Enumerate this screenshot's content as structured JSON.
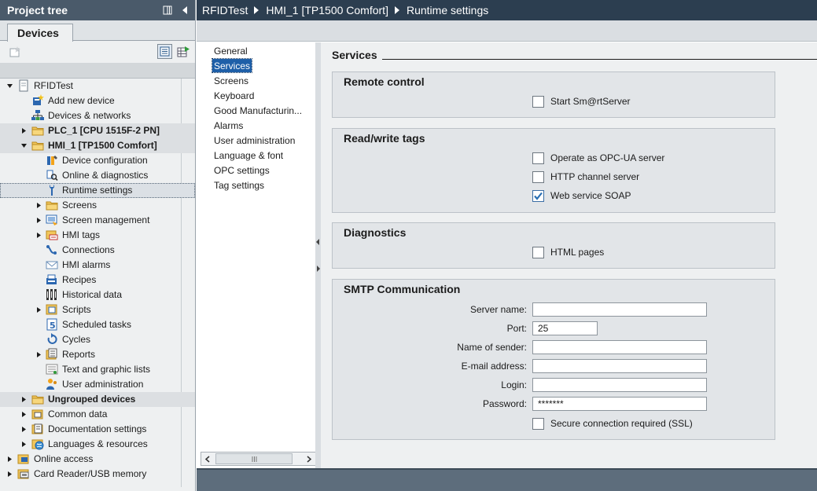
{
  "project_tree": {
    "title": "Project tree",
    "tab_label": "Devices",
    "items": [
      {
        "label": "RFIDTest",
        "level": 0,
        "chevron": "down",
        "icon": "project-icon",
        "bold": false
      },
      {
        "label": "Add new device",
        "level": 1,
        "chevron": "none",
        "icon": "add-device-icon",
        "bold": false
      },
      {
        "label": "Devices & networks",
        "level": 1,
        "chevron": "none",
        "icon": "network-icon",
        "bold": false
      },
      {
        "label": "PLC_1 [CPU 1515F-2 PN]",
        "level": 1,
        "chevron": "right",
        "icon": "folder-icon",
        "bold": true
      },
      {
        "label": "HMI_1 [TP1500 Comfort]",
        "level": 1,
        "chevron": "down",
        "icon": "folder-icon",
        "bold": true
      },
      {
        "label": "Device configuration",
        "level": 2,
        "chevron": "none",
        "icon": "device-config-icon",
        "bold": false
      },
      {
        "label": "Online & diagnostics",
        "level": 2,
        "chevron": "none",
        "icon": "diagnostics-icon",
        "bold": false
      },
      {
        "label": "Runtime settings",
        "level": 2,
        "chevron": "none",
        "icon": "runtime-settings-icon",
        "bold": false,
        "selected": true
      },
      {
        "label": "Screens",
        "level": 2,
        "chevron": "right",
        "icon": "folder-icon",
        "bold": false
      },
      {
        "label": "Screen management",
        "level": 2,
        "chevron": "right",
        "icon": "screen-management-icon",
        "bold": false
      },
      {
        "label": "HMI tags",
        "level": 2,
        "chevron": "right",
        "icon": "tags-icon",
        "bold": false
      },
      {
        "label": "Connections",
        "level": 2,
        "chevron": "none",
        "icon": "connections-icon",
        "bold": false
      },
      {
        "label": "HMI alarms",
        "level": 2,
        "chevron": "none",
        "icon": "alarms-icon",
        "bold": false
      },
      {
        "label": "Recipes",
        "level": 2,
        "chevron": "none",
        "icon": "recipes-icon",
        "bold": false
      },
      {
        "label": "Historical data",
        "level": 2,
        "chevron": "none",
        "icon": "historical-data-icon",
        "bold": false
      },
      {
        "label": "Scripts",
        "level": 2,
        "chevron": "right",
        "icon": "scripts-icon",
        "bold": false
      },
      {
        "label": "Scheduled tasks",
        "level": 2,
        "chevron": "none",
        "icon": "scheduled-tasks-icon",
        "bold": false
      },
      {
        "label": "Cycles",
        "level": 2,
        "chevron": "none",
        "icon": "cycles-icon",
        "bold": false
      },
      {
        "label": "Reports",
        "level": 2,
        "chevron": "right",
        "icon": "reports-icon",
        "bold": false
      },
      {
        "label": "Text and graphic lists",
        "level": 2,
        "chevron": "none",
        "icon": "text-lists-icon",
        "bold": false
      },
      {
        "label": "User administration",
        "level": 2,
        "chevron": "none",
        "icon": "users-icon",
        "bold": false
      },
      {
        "label": "Ungrouped devices",
        "level": 1,
        "chevron": "right",
        "icon": "folder-icon",
        "bold": true
      },
      {
        "label": "Common data",
        "level": 1,
        "chevron": "right",
        "icon": "common-data-icon",
        "bold": false
      },
      {
        "label": "Documentation settings",
        "level": 1,
        "chevron": "right",
        "icon": "documentation-icon",
        "bold": false
      },
      {
        "label": "Languages & resources",
        "level": 1,
        "chevron": "right",
        "icon": "languages-icon",
        "bold": false
      },
      {
        "label": "Online access",
        "level": 0,
        "chevron": "right",
        "icon": "online-access-icon",
        "bold": false
      },
      {
        "label": "Card Reader/USB memory",
        "level": 0,
        "chevron": "right",
        "icon": "card-reader-icon",
        "bold": false
      }
    ]
  },
  "breadcrumb": [
    "RFIDTest",
    "HMI_1 [TP1500 Comfort]",
    "Runtime settings"
  ],
  "nav": {
    "items": [
      "General",
      "Services",
      "Screens",
      "Keyboard",
      "Good Manufacturin...",
      "Alarms",
      "User administration",
      "Language & font",
      "OPC settings",
      "Tag settings"
    ],
    "active": "Services"
  },
  "services": {
    "title": "Services",
    "remote_control": {
      "title": "Remote control",
      "start_smartserver": {
        "label": "Start Sm@rtServer",
        "checked": false
      }
    },
    "read_write_tags": {
      "title": "Read/write tags",
      "opc_ua": {
        "label": " Operate as OPC-UA server",
        "checked": false
      },
      "http_channel": {
        "label": "HTTP channel server",
        "checked": false
      },
      "soap": {
        "label": "Web service SOAP",
        "checked": true
      }
    },
    "diagnostics": {
      "title": "Diagnostics",
      "html_pages": {
        "label": "HTML pages",
        "checked": false
      }
    },
    "smtp": {
      "title": "SMTP Communication",
      "server_name_label": "Server name:",
      "server_name_value": "",
      "port_label": "Port:",
      "port_value": "25",
      "sender_label": "Name of sender:",
      "sender_value": "",
      "email_label": "E-mail address:",
      "email_value": "",
      "login_label": "Login:",
      "login_value": "",
      "password_label": "Password:",
      "password_value": "*******",
      "ssl": {
        "label": "Secure connection required (SSL)",
        "checked": false
      }
    }
  },
  "colors": {
    "breadcrumb_bg": "#2c3e50",
    "tree_header_bg": "#4a5a6a",
    "nav_active": "#1e5fa8",
    "checkbox_check": "#2a6fb3"
  }
}
